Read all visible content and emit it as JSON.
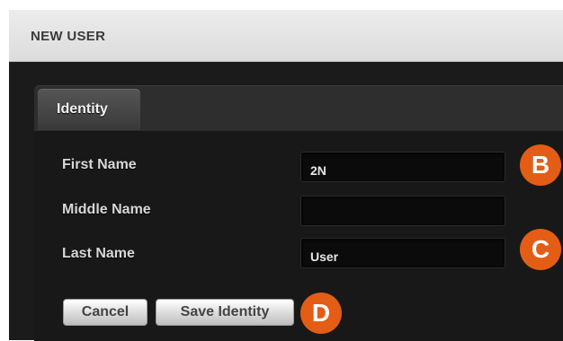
{
  "header": {
    "title": "NEW USER"
  },
  "tabs": [
    {
      "label": "Identity"
    }
  ],
  "form": {
    "first_name": {
      "label": "First Name",
      "value": "2N"
    },
    "middle_name": {
      "label": "Middle Name",
      "value": ""
    },
    "last_name": {
      "label": "Last Name",
      "value": "User"
    }
  },
  "buttons": {
    "cancel": "Cancel",
    "save": "Save Identity"
  },
  "markers": {
    "b": "B",
    "c": "C",
    "d": "D"
  },
  "colors": {
    "marker": "#e35d16",
    "panel": "#1b1b1b",
    "header": "#e4e4e4"
  }
}
